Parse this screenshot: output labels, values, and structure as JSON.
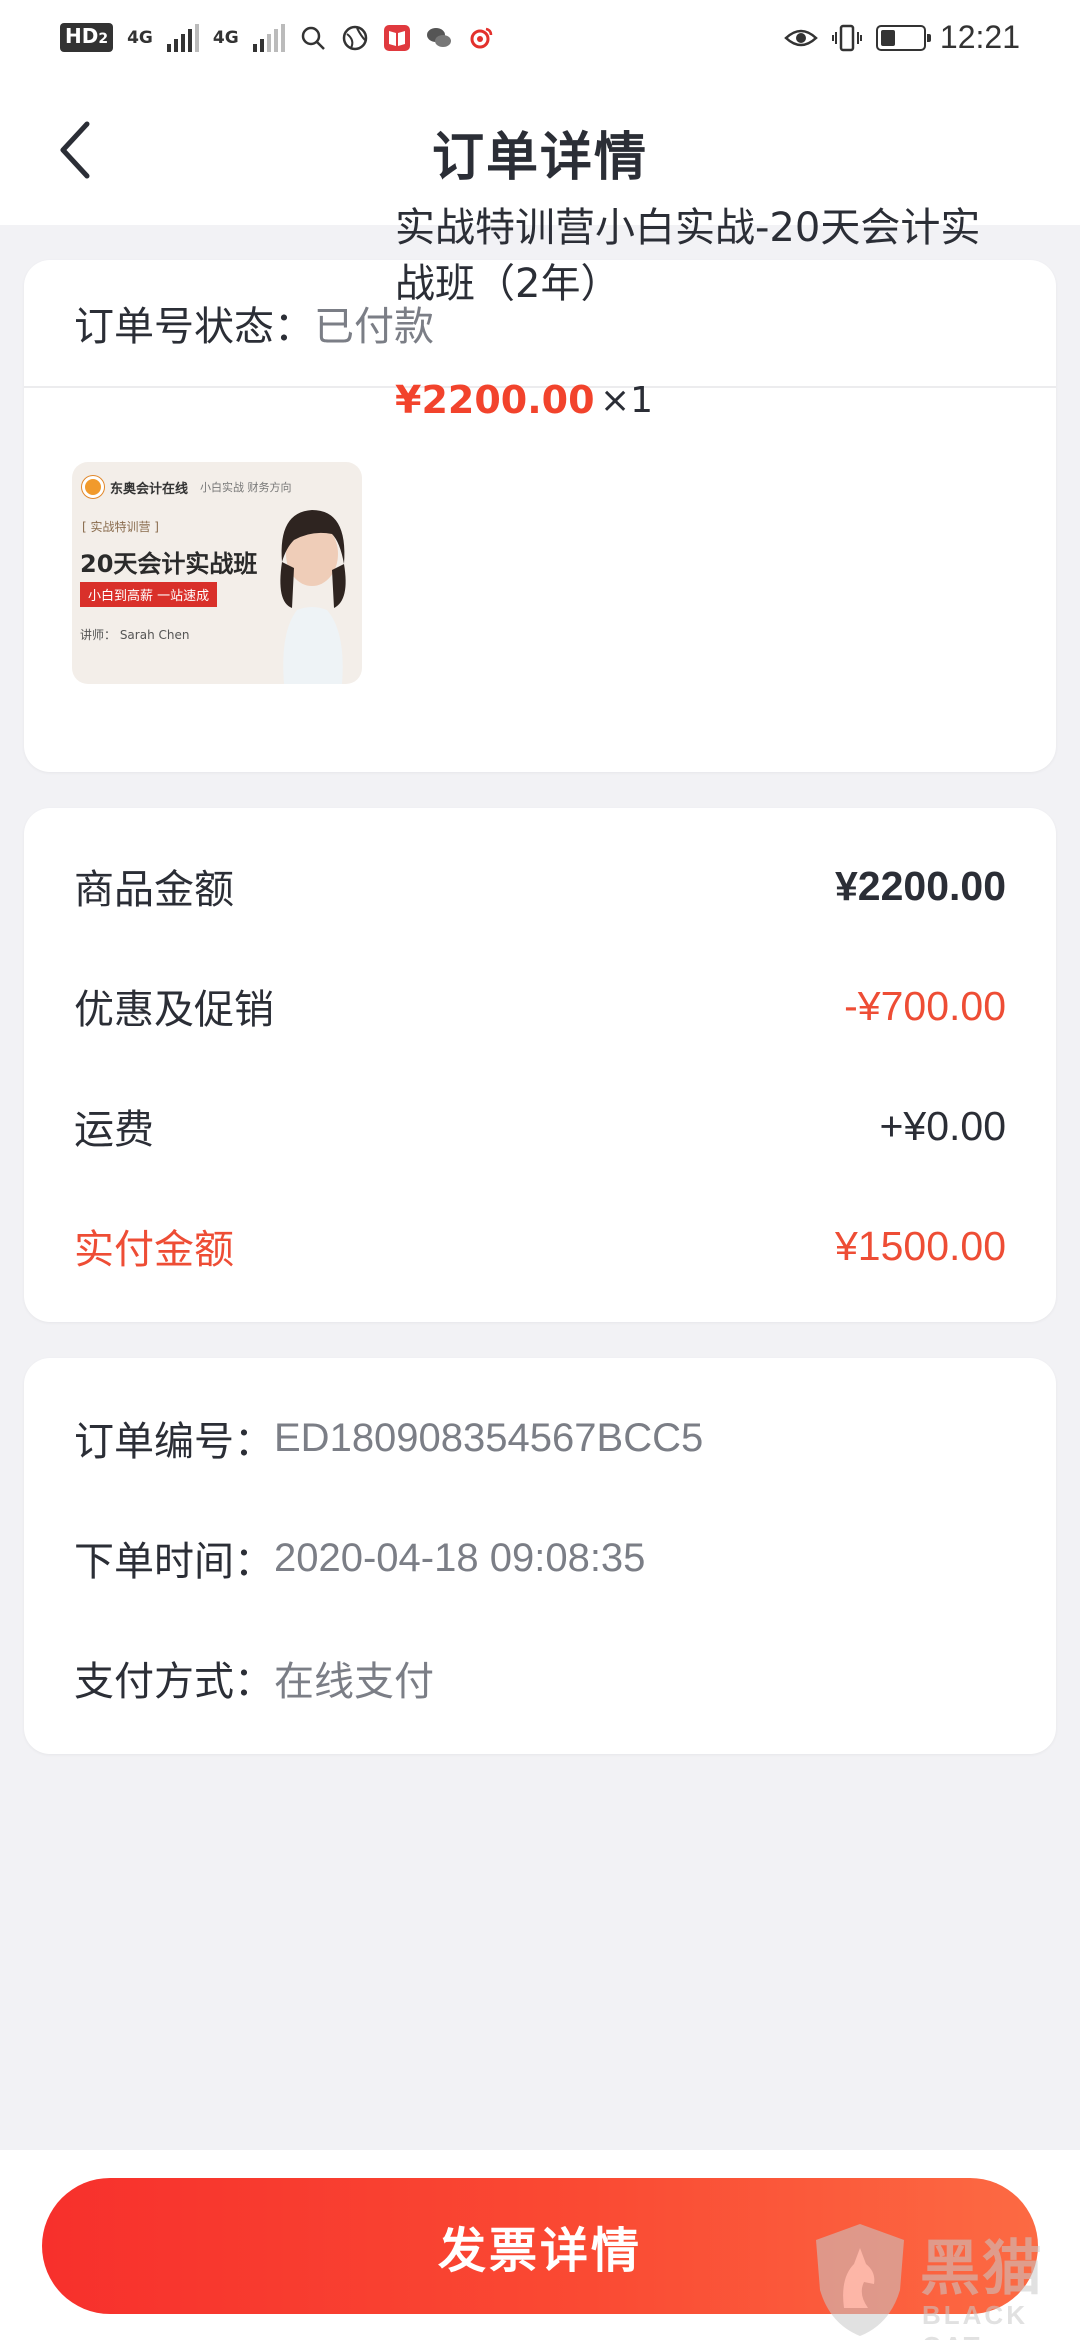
{
  "status_bar": {
    "hd_badge": "HD",
    "hd_sub": "2",
    "net1": "4G",
    "net2": "4G",
    "time": "12:21",
    "battery_level": 0.35
  },
  "header": {
    "title": "订单详情",
    "back_icon": "chevron-left-icon"
  },
  "order_status": {
    "label": "订单号状态：",
    "value": "已付款"
  },
  "product": {
    "thumbnail": {
      "brand": "东奥会计在线",
      "subtitle": "小白实战  财务方向",
      "tag": "[ 实战特训营 ]",
      "title": "20天会计实战班",
      "slogan": "小白到高薪 一站速成",
      "teacher": "讲师：  Sarah Chen"
    },
    "title": "实战特训营小白实战-20天会计实战班（2年）",
    "price": "¥2200.00",
    "quantity": "×1"
  },
  "amounts": [
    {
      "label": "商品金额",
      "value": "¥2200.00"
    },
    {
      "label": "优惠及促销",
      "value": "-¥700.00"
    },
    {
      "label": "运费",
      "value": "+¥0.00"
    },
    {
      "label": "实付金额",
      "value": "¥1500.00"
    }
  ],
  "info": [
    {
      "label": "订单编号：",
      "value": "ED180908354567BCC5"
    },
    {
      "label": "下单时间：",
      "value": "2020-04-18 09:08:35"
    },
    {
      "label": "支付方式：",
      "value": "在线支付"
    }
  ],
  "footer": {
    "invoice_button": "发票详情"
  },
  "watermark": {
    "text": "黑猫",
    "sub": "BLACK CAT"
  },
  "colors": {
    "accent_red": "#f2432c",
    "button_gradient_start": "#f7302c",
    "button_gradient_end": "#fc6a43",
    "page_bg": "#f2f2f5"
  }
}
